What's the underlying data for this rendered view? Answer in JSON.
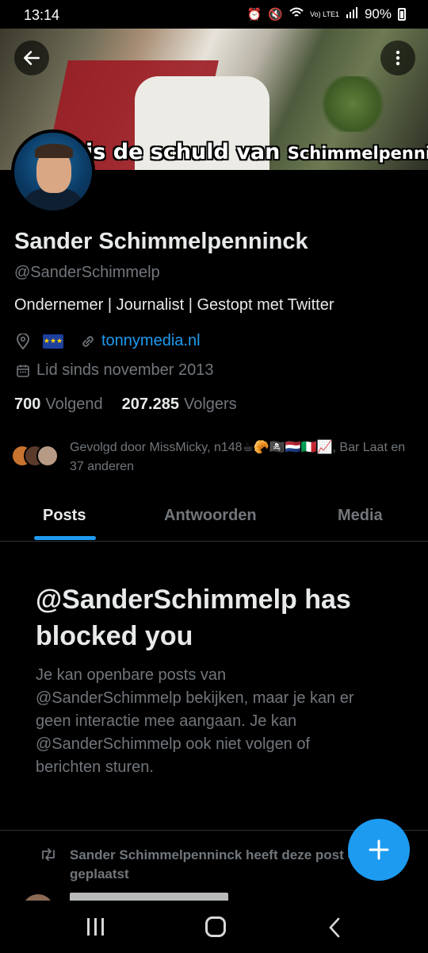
{
  "status_bar": {
    "time": "13:14",
    "network": "Vo) LTE1",
    "battery": "90%"
  },
  "banner": {
    "caption_prefix": "is de schuld van",
    "caption_name": "Schimmelpenninck"
  },
  "profile": {
    "name": "Sander Schimmelpenninck",
    "handle": "@SanderSchimmelp",
    "bio": "Ondernemer | Journalist | Gestopt met Twitter",
    "website": "tonnymedia.nl",
    "joined": "Lid sinds november 2013",
    "following_count": "700",
    "following_label": "Volgend",
    "followers_count": "207.285",
    "followers_label": "Volgers",
    "followed_by": "Gevolgd door MissMicky, n148☕🥐🏴‍☠️🇳🇱🇮🇹📈, Bar Laat en 37 anderen"
  },
  "tabs": [
    {
      "label": "Posts",
      "active": true
    },
    {
      "label": "Antwoorden",
      "active": false
    },
    {
      "label": "Media",
      "active": false
    }
  ],
  "blocked": {
    "title": "@SanderSchimmelp has blocked you",
    "body": "Je kan openbare posts van @SanderSchimmelp bekijken, maar je kan er geen interactie mee aangaan. Je kan @SanderSchimmelp ook niet volgen of berichten sturen."
  },
  "repost_notice": "Sander Schimmelpenninck heeft deze post opnieuw geplaatst",
  "colors": {
    "accent": "#1d9bf0",
    "secondary_text": "#71767b",
    "primary_text": "#e7e9ea",
    "background": "#000000"
  },
  "icons": [
    "back-arrow-icon",
    "more-vertical-icon",
    "location-icon",
    "link-icon",
    "calendar-icon",
    "repost-icon",
    "plus-icon"
  ]
}
